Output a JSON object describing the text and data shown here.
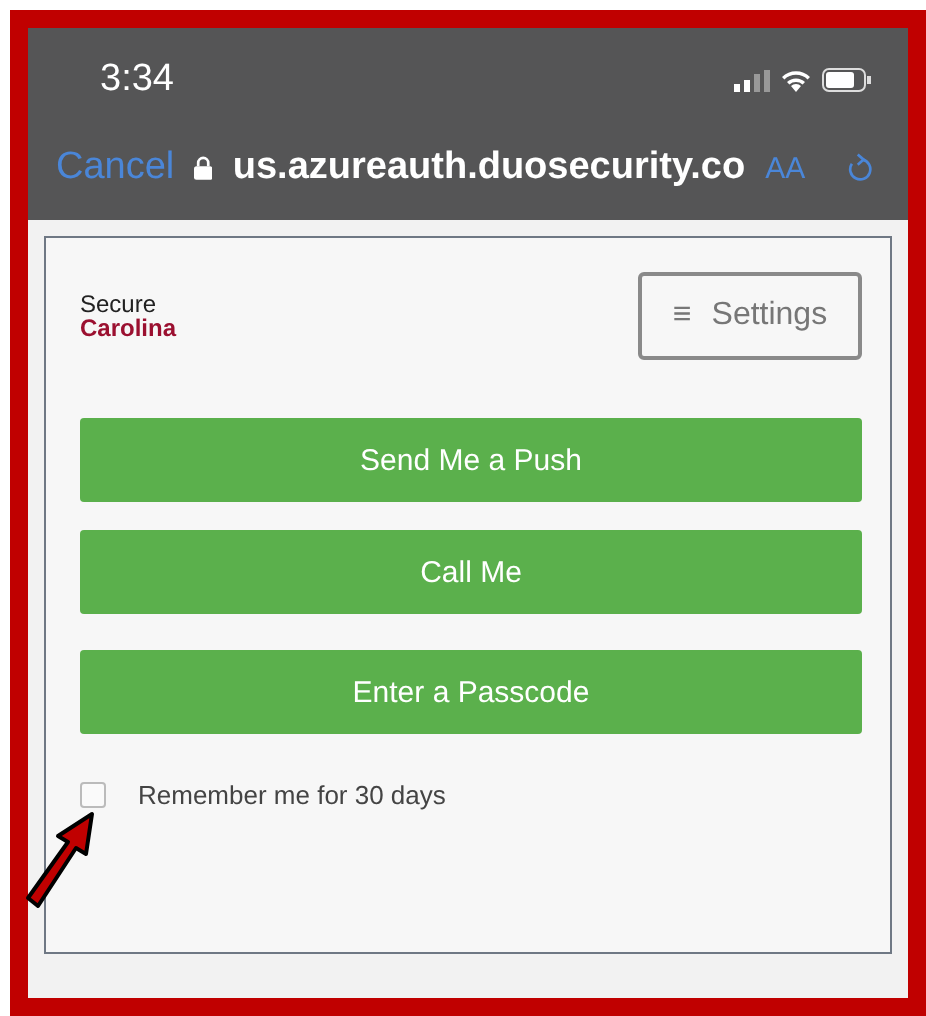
{
  "status_bar": {
    "time": "3:34"
  },
  "browser_bar": {
    "cancel": "Cancel",
    "url": "us.azureauth.duosecurity.co",
    "text_size": "AA"
  },
  "logo": {
    "line_1": "Secure",
    "line_2": "Carolina"
  },
  "settings_button": {
    "icon": "≡",
    "label": "Settings"
  },
  "actions": [
    {
      "label": "Send Me a Push"
    },
    {
      "label": "Call Me"
    },
    {
      "label": "Enter a Passcode"
    }
  ],
  "remember": {
    "label": "Remember me for 30 days",
    "checked": false
  }
}
